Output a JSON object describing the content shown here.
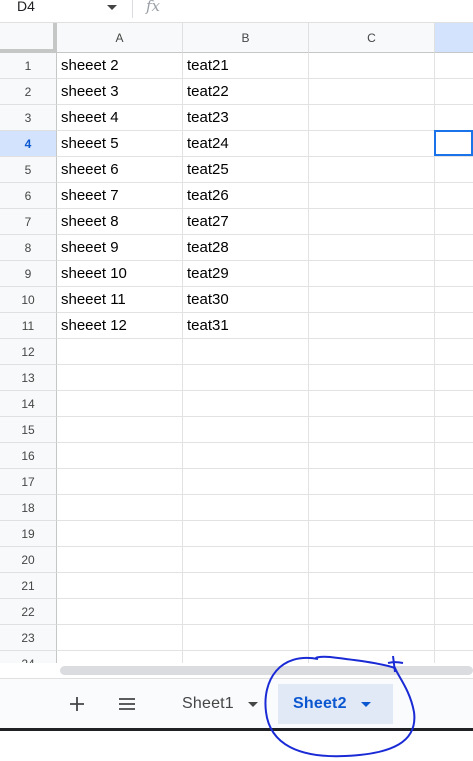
{
  "formula_bar": {
    "name_box": "D4",
    "fx_label": "fx",
    "formula_value": ""
  },
  "grid": {
    "columns": [
      "A",
      "B",
      "C"
    ],
    "row_numbers": [
      "1",
      "2",
      "3",
      "4",
      "5",
      "6",
      "7",
      "8",
      "9",
      "10",
      "11",
      "12",
      "13",
      "14",
      "15",
      "16",
      "17",
      "18",
      "19",
      "20",
      "21",
      "22",
      "23",
      "24"
    ],
    "selected_row": "4",
    "rows": [
      [
        "sheeet 2",
        "teat21"
      ],
      [
        "sheeet 3",
        "teat22"
      ],
      [
        "sheeet 4",
        "teat23"
      ],
      [
        "sheeet 5",
        "teat24"
      ],
      [
        "sheeet 6",
        "teat25"
      ],
      [
        "sheeet 7",
        "teat26"
      ],
      [
        "sheeet 8",
        "teat27"
      ],
      [
        "sheeet 9",
        "teat28"
      ],
      [
        "sheeet 10",
        "teat29"
      ],
      [
        "sheeet 11",
        "teat30"
      ],
      [
        "sheeet 12",
        "teat31"
      ]
    ]
  },
  "sheet_tabs": {
    "add_icon": "plus-icon",
    "all_sheets_icon": "menu-icon",
    "tabs": [
      {
        "label": "Sheet1",
        "active": false
      },
      {
        "label": "Sheet2",
        "active": true
      }
    ]
  },
  "colors": {
    "active_tab_text": "#0b57d0",
    "active_tab_bg": "#e1e9f7",
    "selection": "#1a73e8",
    "annotation_ink": "#1a2bd6"
  }
}
